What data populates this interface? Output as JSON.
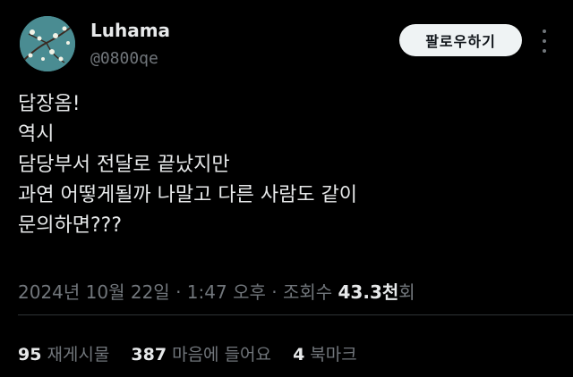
{
  "author": {
    "display_name": "Luhama",
    "handle": "@0800qe",
    "avatar_icon": "almond-blossom-avatar"
  },
  "follow_button": {
    "label": "팔로우하기"
  },
  "more_icon": "more-vertical-icon",
  "tweet": {
    "lines": [
      "답장옴!",
      "역시",
      "담당부서 전달로 끝났지만",
      "과연 어떻게될까 나말고 다른 사람도 같이",
      "문의하면???"
    ]
  },
  "meta": {
    "date": "2024년 10월 22일",
    "time": "1:47 오후",
    "views_label_prefix": "조회수",
    "views_count": "43.3천",
    "views_suffix": "회",
    "separator": "·"
  },
  "stats": {
    "reposts": {
      "count": "95",
      "label": "재게시물"
    },
    "likes": {
      "count": "387",
      "label": "마음에 들어요"
    },
    "bookmarks": {
      "count": "4",
      "label": "북마크"
    }
  },
  "colors": {
    "background": "#000000",
    "primary_text": "#e7e9ea",
    "secondary_text": "#71767b",
    "button_bg": "#eff3f4"
  }
}
